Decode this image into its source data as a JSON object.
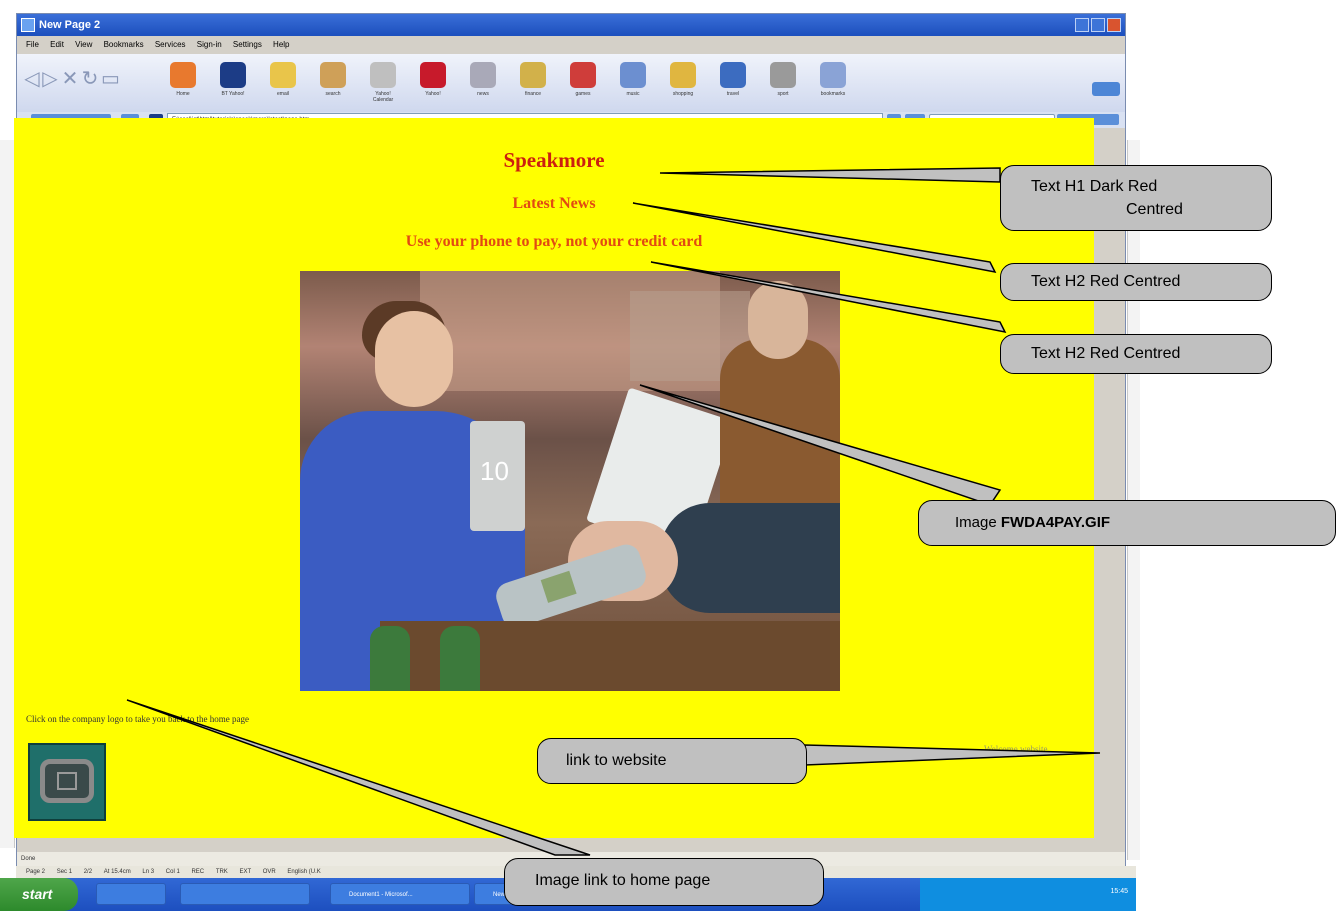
{
  "window": {
    "title": "New Page 2",
    "menu": [
      "File",
      "Edit",
      "View",
      "Bookmarks",
      "Services",
      "Sign-in",
      "Settings",
      "Help"
    ],
    "toolbar_items": [
      "Home",
      "BT Yahoo!",
      "email",
      "search",
      "Yahoo! Calendar",
      "Yahoo!",
      "news",
      "finance",
      "games",
      "music",
      "shopping",
      "travel",
      "sport",
      "bookmarks"
    ],
    "address_url": "E:\\cool\\ict\\html\\tutorials\\speak\\more\\latest\\page.htm"
  },
  "page": {
    "h1": "Speakmore",
    "h2_latest": "Latest News",
    "h2_headline": "Use your phone to pay, not your credit card",
    "photo_number": "10",
    "instruction": "Click on the company logo to take you back to the home page",
    "website_link": "Welcome website"
  },
  "statusbar": {
    "text": "Done"
  },
  "word_status": [
    "Page 2",
    "Sec 1",
    "2/2",
    "At 15.4cm",
    "Ln 3",
    "Col 1",
    "REC",
    "TRK",
    "EXT",
    "OVR",
    "English (U.K"
  ],
  "taskbar": {
    "start": "start",
    "tasks": [
      "Document1 - Microsof...",
      "New Page 2"
    ],
    "clock": "15:45"
  },
  "callouts": {
    "h1": [
      "Text H1 Dark Red",
      "Centred"
    ],
    "h2_latest": "Text H2 Red Centred",
    "h2_headline": "Text H2 Red Centred",
    "image_label": "Image ",
    "image_file": "FWDA4PAY.GIF",
    "website": "link to website",
    "home_image": "Image link to home page"
  },
  "colors": {
    "page_background": "#ffff00",
    "h1": "#cc1f0f",
    "h2": "#e24a12",
    "callout": "#c0c0c0"
  }
}
